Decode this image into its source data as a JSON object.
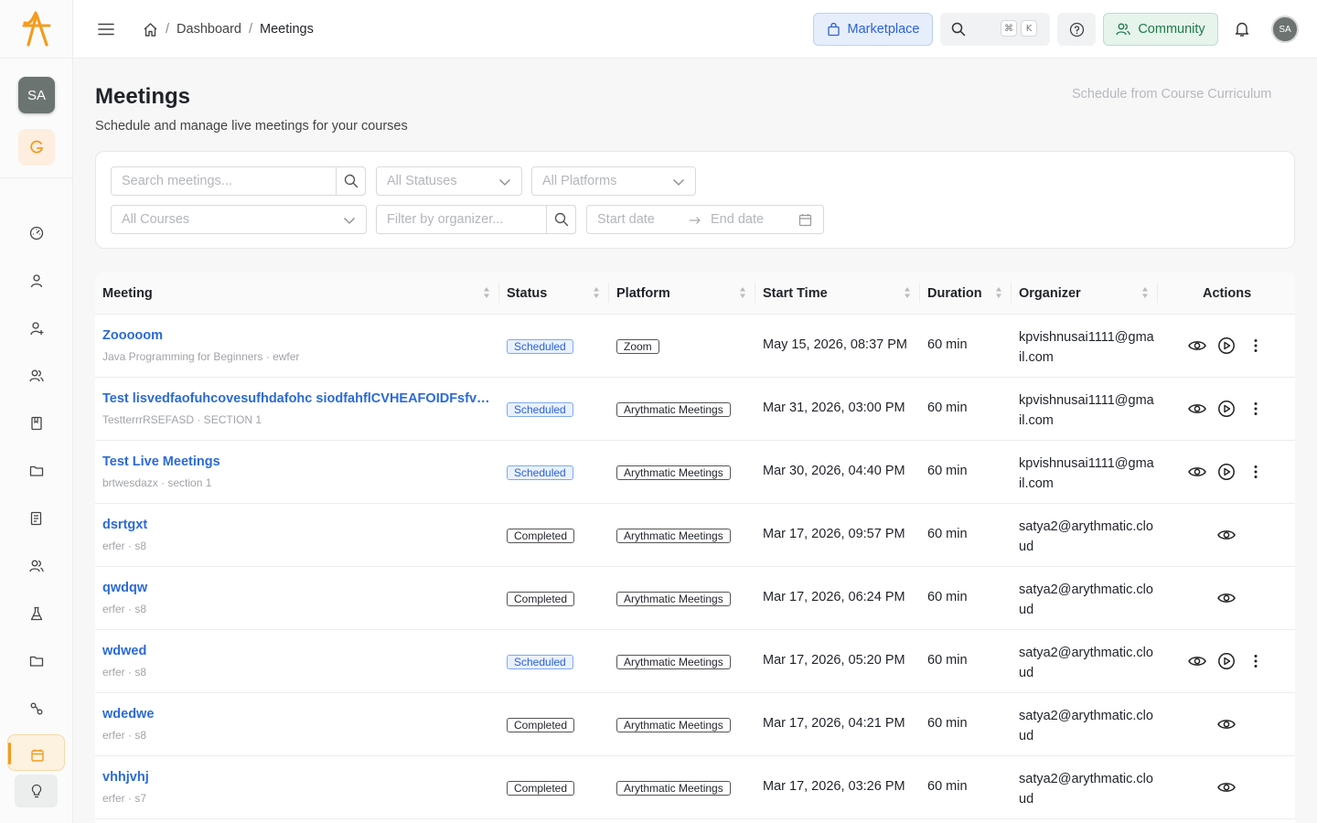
{
  "header": {
    "breadcrumb": [
      "Dashboard",
      "Meetings"
    ],
    "marketplace_label": "Marketplace",
    "search_kbd": [
      "⌘",
      "K"
    ],
    "community_label": "Community",
    "avatar_initials": "SA"
  },
  "sidebar": {
    "avatar_initials": "SA",
    "brand_color": "#f39c1f",
    "icons": [
      "dashboard-icon",
      "user-icon",
      "user-add-icon",
      "users-icon",
      "book-icon",
      "folder-icon",
      "report-icon",
      "users-icon",
      "flask-icon",
      "folder-icon",
      "integration-icon",
      "calendar-icon",
      "bulb-icon"
    ],
    "active_item": "calendar-icon"
  },
  "page": {
    "title": "Meetings",
    "subtitle": "Schedule and manage live meetings for your courses",
    "schedule_link": "Schedule from Course Curriculum"
  },
  "filters": {
    "search_placeholder": "Search meetings...",
    "status_placeholder": "All Statuses",
    "platform_placeholder": "All Platforms",
    "course_placeholder": "All Courses",
    "organizer_placeholder": "Filter by organizer...",
    "start_date_placeholder": "Start date",
    "end_date_placeholder": "End date"
  },
  "table": {
    "columns": [
      "Meeting",
      "Status",
      "Platform",
      "Start Time",
      "Duration",
      "Organizer",
      "Actions"
    ],
    "rows": [
      {
        "title": "Zooooom",
        "subtitle": "Java Programming for Beginners · ewfer",
        "status": "Scheduled",
        "platform": "Zoom",
        "start": "May 15, 2026, 08:37 PM",
        "duration": "60 min",
        "organizer": "kpvishnusai1111@gmail.com"
      },
      {
        "title": "Test lisvedfaofuhcovesufhdafohc siodfahflCVHEAFOIDFsfvgsdfs",
        "subtitle": "TestterrrRSEFASD · SECTION 1",
        "status": "Scheduled",
        "platform": "Arythmatic Meetings",
        "start": "Mar 31, 2026, 03:00 PM",
        "duration": "60 min",
        "organizer": "kpvishnusai1111@gmail.com"
      },
      {
        "title": "Test Live Meetings",
        "subtitle": "brtwesdazx · section 1",
        "status": "Scheduled",
        "platform": "Arythmatic Meetings",
        "start": "Mar 30, 2026, 04:40 PM",
        "duration": "60 min",
        "organizer": "kpvishnusai1111@gmail.com"
      },
      {
        "title": "dsrtgxt",
        "subtitle": "erfer · s8",
        "status": "Completed",
        "platform": "Arythmatic Meetings",
        "start": "Mar 17, 2026, 09:57 PM",
        "duration": "60 min",
        "organizer": "satya2@arythmatic.cloud"
      },
      {
        "title": "qwdqw",
        "subtitle": "erfer · s8",
        "status": "Completed",
        "platform": "Arythmatic Meetings",
        "start": "Mar 17, 2026, 06:24 PM",
        "duration": "60 min",
        "organizer": "satya2@arythmatic.cloud"
      },
      {
        "title": "wdwed",
        "subtitle": "erfer · s8",
        "status": "Scheduled",
        "platform": "Arythmatic Meetings",
        "start": "Mar 17, 2026, 05:20 PM",
        "duration": "60 min",
        "organizer": "satya2@arythmatic.cloud"
      },
      {
        "title": "wdedwe",
        "subtitle": "erfer · s8",
        "status": "Completed",
        "platform": "Arythmatic Meetings",
        "start": "Mar 17, 2026, 04:21 PM",
        "duration": "60 min",
        "organizer": "satya2@arythmatic.cloud"
      },
      {
        "title": "vhhjvhj",
        "subtitle": "erfer · s7",
        "status": "Completed",
        "platform": "Arythmatic Meetings",
        "start": "Mar 17, 2026, 03:26 PM",
        "duration": "60 min",
        "organizer": "satya2@arythmatic.cloud"
      }
    ]
  }
}
